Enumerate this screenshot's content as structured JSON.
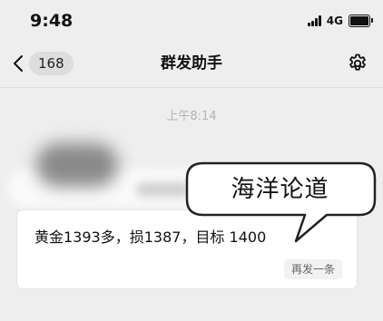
{
  "status_bar": {
    "time": "9:48",
    "network": "4G",
    "signal_icon": "signal-bars-icon",
    "battery_icon": "battery-icon"
  },
  "nav": {
    "back_icon": "chevron-left-icon",
    "unread_count": "168",
    "title": "群发助手",
    "settings_icon": "gear-icon"
  },
  "chat": {
    "timestamp": "上午8:14",
    "message": {
      "text": "黄金1393多，损1387，目标 1400",
      "resend_label": "再发一条"
    }
  },
  "annotation": {
    "callout_text": "海洋论道"
  },
  "colors": {
    "background": "#eeeeee",
    "card": "#ffffff",
    "timestamp": "#b3b3b3"
  }
}
